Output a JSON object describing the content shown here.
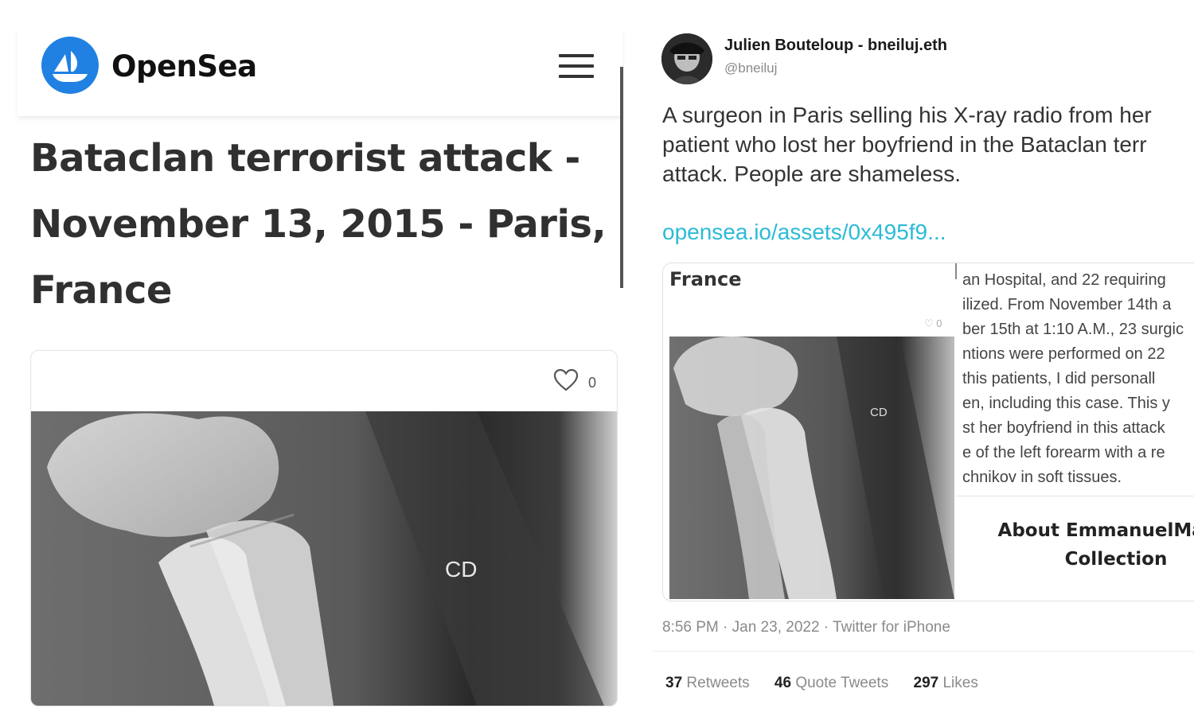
{
  "opensea": {
    "brand": "OpenSea",
    "title_lines": [
      "Bataclan terrorist attack -",
      "November 13, 2015 - Paris,",
      "France"
    ],
    "like_count": "0",
    "xray_label": "CD"
  },
  "tweet": {
    "author_name": "Julien Bouteloup - bneiluj.eth",
    "handle": "@bneiluj",
    "text_lines": [
      "A surgeon in Paris selling his X-ray radio from her",
      "patient who lost her boyfriend in the Bataclan terr",
      "attack. People are shameless."
    ],
    "link": "opensea.io/assets/0x495f9...",
    "embed": {
      "title": "France",
      "like_count": "0",
      "xray_label": "CD",
      "desc_lines": [
        "an Hospital, and 22 requiring",
        "ilized. From November 14th a",
        "ber 15th at 1:10 A.M., 23 surgic",
        "ntions were performed on 22",
        "this patients, I did personall",
        "en, including this case. This y",
        "st her boyfriend in this attack",
        "e of the left forearm with a re",
        "chnikov in soft tissues."
      ],
      "about_lines": [
        "About EmmanuelMasm",
        "Collection"
      ]
    },
    "meta": "8:56 PM · Jan 23, 2022 · Twitter for iPhone",
    "stats": {
      "retweets_count": "37",
      "retweets_label": "Retweets",
      "quotes_count": "46",
      "quotes_label": "Quote Tweets",
      "likes_count": "297",
      "likes_label": "Likes"
    }
  },
  "colors": {
    "opensea_blue": "#2081e2",
    "link_color": "#2bbbd6",
    "title_color": "#303030"
  }
}
